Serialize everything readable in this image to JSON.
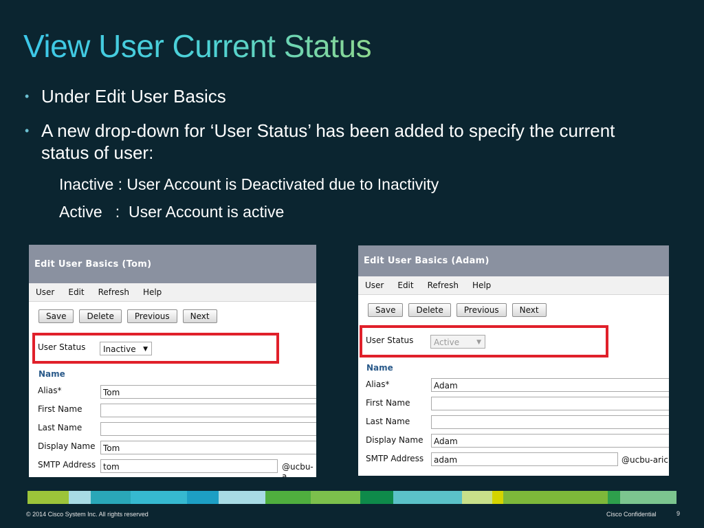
{
  "slide": {
    "title": "View User Current Status",
    "bullets": [
      "Under Edit User Basics",
      "A new drop-down for ‘User Status’ has been added to specify the current status of user:"
    ],
    "sub_items": [
      "Inactive : User Account is Deactivated due to Inactivity",
      "Active   :  User Account is active"
    ]
  },
  "left_shot": {
    "header": "Edit User Basics  (Tom)",
    "menu": [
      "User",
      "Edit",
      "Refresh",
      "Help"
    ],
    "buttons": [
      "Save",
      "Delete",
      "Previous",
      "Next"
    ],
    "user_status_label": "User Status",
    "user_status_value": "Inactive",
    "section": "Name",
    "alias_label": "Alias*",
    "alias_value": "Tom",
    "first_name_label": "First Name",
    "last_name_label": "Last Name",
    "display_name_label": "Display Name",
    "display_name_value": "Tom",
    "smtp_label": "SMTP Address",
    "smtp_value": "tom",
    "smtp_domain": "@ucbu-a"
  },
  "right_shot": {
    "header": "Edit User Basics  (Adam)",
    "menu": [
      "User",
      "Edit",
      "Refresh",
      "Help"
    ],
    "buttons": [
      "Save",
      "Delete",
      "Previous",
      "Next"
    ],
    "user_status_label": "User Status",
    "user_status_value": "Active",
    "section": "Name",
    "alias_label": "Alias*",
    "alias_value": "Adam",
    "first_name_label": "First Name",
    "last_name_label": "Last Name",
    "display_name_label": "Display Name",
    "display_name_value": "Adam",
    "smtp_label": "SMTP Address",
    "smtp_value": "adam",
    "smtp_domain": "@ucbu-aric"
  },
  "footer": {
    "copyright": "© 2014 Cisco System Inc. All rights reserved",
    "confidential": "Cisco Confidential",
    "page": "9"
  },
  "colors": {
    "background": "#0b2530",
    "highlight": "#e0202a",
    "colorbar": [
      "#9cc43a",
      "#a8dbe4",
      "#2aa7b8",
      "#36b9d0",
      "#1d9fc4",
      "#a8dbe4",
      "#4fae3e",
      "#7cc04c",
      "#0e8a4a",
      "#5bc2c8",
      "#c8e08a",
      "#d4d400",
      "#7db83a",
      "#2e9f4c",
      "#7cc58f"
    ]
  }
}
